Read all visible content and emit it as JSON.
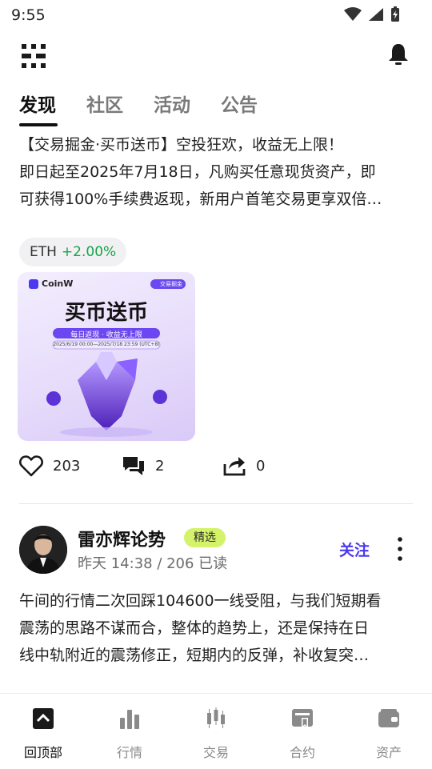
{
  "status_bar": {
    "time": "9:55"
  },
  "tabs": [
    {
      "label": "发现",
      "active": true
    },
    {
      "label": "社区",
      "active": false
    },
    {
      "label": "活动",
      "active": false
    },
    {
      "label": "公告",
      "active": false
    }
  ],
  "post1": {
    "lines": [
      "【交易掘金·买币送币】空投狂欢，收益无上限！",
      "即日起至2025年7月18日，凡购买任意现货资产，即",
      "可获得100%手续费返现，新用户首笔交易更享双倍…"
    ],
    "tag": {
      "symbol": "ETH",
      "change": "+2.00%"
    },
    "banner": {
      "brand": "CoinW",
      "chip": "交易掘金",
      "headline": "买币送币",
      "sub": "每日返现 · 收益无上限",
      "date": "2025/6/19 00:00—2025/7/18 23:59 (UTC+8)"
    },
    "likes": "203",
    "comments": "2",
    "shares": "0"
  },
  "post2": {
    "author": "雷亦辉论势",
    "badge": "精选",
    "meta": "昨天 14:38 / 206 已读",
    "follow": "关注",
    "lines": [
      "午间的行情二次回踩104600一线受阻，与我们短期看",
      "震荡的思路不谋而合，整体的趋势上，还是保持在日",
      "线中轨附近的震荡修正，短期内的反弹，补收复突…"
    ]
  },
  "bottom_nav": [
    {
      "label": "回顶部",
      "icon": "back-to-top-icon",
      "active": true
    },
    {
      "label": "行情",
      "icon": "market-chart-icon",
      "active": false
    },
    {
      "label": "交易",
      "icon": "candlestick-icon",
      "active": false
    },
    {
      "label": "合约",
      "icon": "contract-icon",
      "active": false
    },
    {
      "label": "资产",
      "icon": "wallet-icon",
      "active": false
    }
  ],
  "colors": {
    "accent": "#4b39f0",
    "gain": "#16a34a",
    "badge": "#d4f36a"
  }
}
